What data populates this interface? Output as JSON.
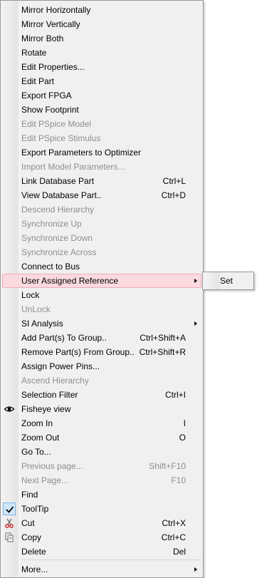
{
  "menu": {
    "items": [
      {
        "label": "Mirror Horizontally",
        "shortcut": "",
        "disabled": false,
        "submenu": false
      },
      {
        "label": "Mirror Vertically",
        "shortcut": "",
        "disabled": false,
        "submenu": false
      },
      {
        "label": "Mirror Both",
        "shortcut": "",
        "disabled": false,
        "submenu": false
      },
      {
        "label": "Rotate",
        "shortcut": "",
        "disabled": false,
        "submenu": false
      },
      {
        "label": "Edit Properties...",
        "shortcut": "",
        "disabled": false,
        "submenu": false
      },
      {
        "label": "Edit Part",
        "shortcut": "",
        "disabled": false,
        "submenu": false
      },
      {
        "label": "Export FPGA",
        "shortcut": "",
        "disabled": false,
        "submenu": false
      },
      {
        "label": "Show Footprint",
        "shortcut": "",
        "disabled": false,
        "submenu": false
      },
      {
        "label": "Edit PSpice Model",
        "shortcut": "",
        "disabled": true,
        "submenu": false
      },
      {
        "label": "Edit PSpice Stimulus",
        "shortcut": "",
        "disabled": true,
        "submenu": false
      },
      {
        "label": "Export Parameters to Optimizer",
        "shortcut": "",
        "disabled": false,
        "submenu": false
      },
      {
        "label": "Import Model Parameters...",
        "shortcut": "",
        "disabled": true,
        "submenu": false
      },
      {
        "label": "Link Database Part",
        "shortcut": "Ctrl+L",
        "disabled": false,
        "submenu": false
      },
      {
        "label": "View Database Part..",
        "shortcut": "Ctrl+D",
        "disabled": false,
        "submenu": false
      },
      {
        "label": "Descend Hierarchy",
        "shortcut": "",
        "disabled": true,
        "submenu": false
      },
      {
        "label": "Synchronize Up",
        "shortcut": "",
        "disabled": true,
        "submenu": false
      },
      {
        "label": "Synchronize Down",
        "shortcut": "",
        "disabled": true,
        "submenu": false
      },
      {
        "label": "Synchronize Across",
        "shortcut": "",
        "disabled": true,
        "submenu": false
      },
      {
        "label": "Connect to Bus",
        "shortcut": "",
        "disabled": false,
        "submenu": false
      },
      {
        "label": "User Assigned Reference",
        "shortcut": "",
        "disabled": false,
        "submenu": true,
        "hover": true
      },
      {
        "label": "Lock",
        "shortcut": "",
        "disabled": false,
        "submenu": false
      },
      {
        "label": "UnLock",
        "shortcut": "",
        "disabled": true,
        "submenu": false
      },
      {
        "label": "SI Analysis",
        "shortcut": "",
        "disabled": false,
        "submenu": true
      },
      {
        "label": "Add Part(s) To Group..",
        "shortcut": "Ctrl+Shift+A",
        "disabled": false,
        "submenu": false
      },
      {
        "label": "Remove Part(s) From Group..",
        "shortcut": "Ctrl+Shift+R",
        "disabled": false,
        "submenu": false
      },
      {
        "label": "Assign Power Pins...",
        "shortcut": "",
        "disabled": false,
        "submenu": false
      },
      {
        "label": "Ascend Hierarchy",
        "shortcut": "",
        "disabled": true,
        "submenu": false
      },
      {
        "label": "Selection Filter",
        "shortcut": "Ctrl+I",
        "disabled": false,
        "submenu": false
      },
      {
        "label": "Fisheye view",
        "shortcut": "",
        "disabled": false,
        "submenu": false,
        "icon": "eye-icon"
      },
      {
        "label": "Zoom In",
        "shortcut": "I",
        "disabled": false,
        "submenu": false
      },
      {
        "label": "Zoom Out",
        "shortcut": "O",
        "disabled": false,
        "submenu": false
      },
      {
        "label": "Go To...",
        "shortcut": "",
        "disabled": false,
        "submenu": false
      },
      {
        "label": "Previous page...",
        "shortcut": "Shift+F10",
        "disabled": true,
        "submenu": false
      },
      {
        "label": "Next Page...",
        "shortcut": "F10",
        "disabled": true,
        "submenu": false
      },
      {
        "label": "Find",
        "shortcut": "",
        "disabled": false,
        "submenu": false
      },
      {
        "label": "ToolTip",
        "shortcut": "",
        "disabled": false,
        "submenu": false,
        "icon": "checkmark-icon"
      },
      {
        "label": "Cut",
        "shortcut": "Ctrl+X",
        "disabled": false,
        "submenu": false,
        "icon": "scissors-icon"
      },
      {
        "label": "Copy",
        "shortcut": "Ctrl+C",
        "disabled": false,
        "submenu": false,
        "icon": "copy-icon"
      },
      {
        "label": "Delete",
        "shortcut": "Del",
        "disabled": false,
        "submenu": false
      }
    ],
    "more_label": "More..."
  },
  "submenu": {
    "items": [
      {
        "label": "Set"
      }
    ]
  },
  "colors": {
    "hover_bg": "#fadadf",
    "hover_border": "#efaeb8",
    "disabled_text": "#8e8e8e"
  }
}
